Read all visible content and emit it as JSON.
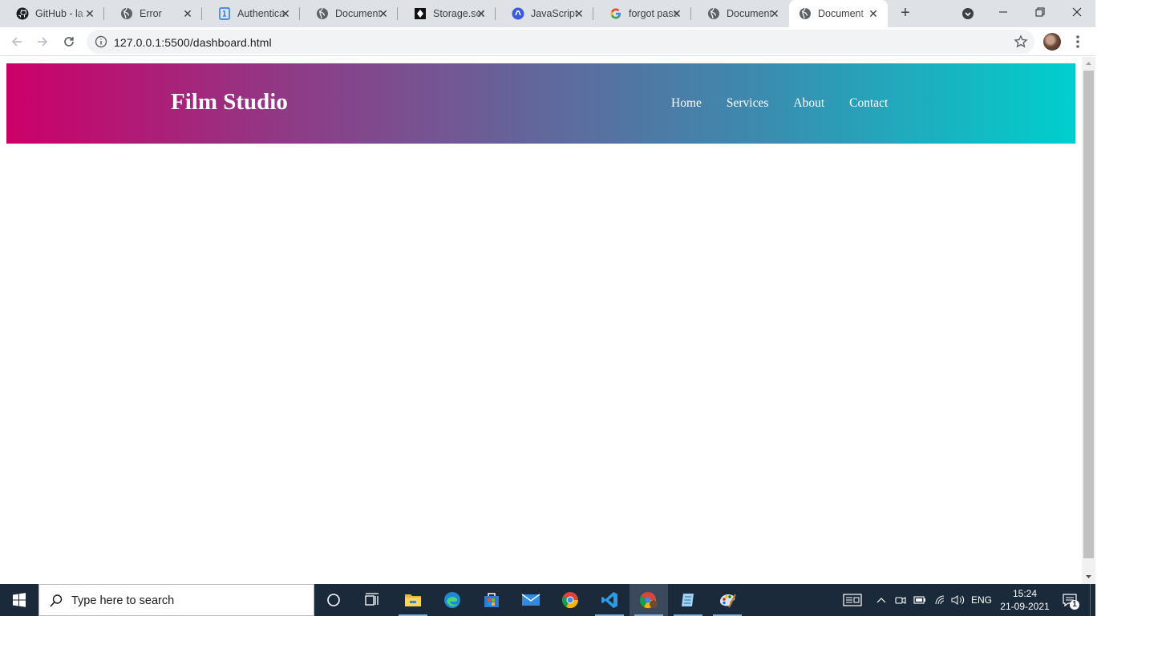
{
  "browser": {
    "tabs": [
      {
        "title": "GitHub - la",
        "icon": "github-icon",
        "active": false
      },
      {
        "title": "Error",
        "icon": "globe-icon",
        "active": false
      },
      {
        "title": "Authentica",
        "icon": "docs-icon",
        "active": false
      },
      {
        "title": "Document",
        "icon": "globe-icon",
        "active": false
      },
      {
        "title": "Storage.set",
        "icon": "storage-icon",
        "active": false
      },
      {
        "title": "JavaScript",
        "icon": "js-icon",
        "active": false
      },
      {
        "title": "forgot pass",
        "icon": "google-icon",
        "active": false
      },
      {
        "title": "Document",
        "icon": "globe-icon",
        "active": false
      },
      {
        "title": "Document",
        "icon": "globe-icon",
        "active": true
      }
    ],
    "new_tab_label": "+",
    "url": "127.0.0.1:5500/dashboard.html"
  },
  "page": {
    "brand": "Film Studio",
    "nav": [
      "Home",
      "Services",
      "About",
      "Contact"
    ],
    "gradient": [
      "#cc0069",
      "#00cfcd"
    ]
  },
  "taskbar": {
    "search_placeholder": "Type here to search",
    "apps": [
      "cortana-icon",
      "task-view-icon",
      "file-explorer-icon",
      "edge-icon",
      "store-icon",
      "mail-icon",
      "chrome-icon",
      "vscode-icon",
      "chrome-profile-icon",
      "notepad-icon",
      "paint-icon"
    ],
    "language": "ENG",
    "time": "15:24",
    "date": "21-09-2021",
    "notification_count": "1"
  }
}
